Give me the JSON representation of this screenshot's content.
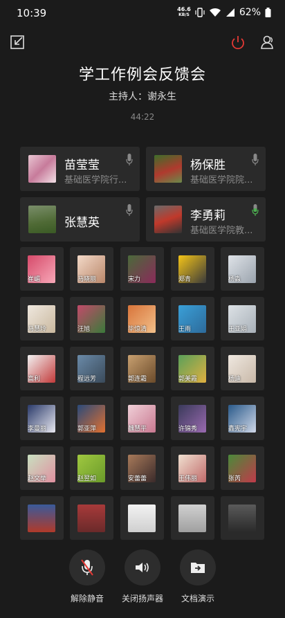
{
  "status": {
    "time": "10:39",
    "net_speed": "46.6",
    "net_unit": "KB/S",
    "battery": "62%"
  },
  "meeting": {
    "title": "学工作例会反馈会",
    "host": "主持人：谢永生",
    "timer": "44:22"
  },
  "speakers": [
    {
      "name": "苗莹莹",
      "dept": "基础医学院行..."
    },
    {
      "name": "杨保胜",
      "dept": "基础医学院院..."
    },
    {
      "name": "张慧英",
      "dept": ""
    },
    {
      "name": "李勇莉",
      "dept": "基础医学院教..."
    }
  ],
  "participants": [
    {
      "name": "崔嵋"
    },
    {
      "name": "马晓丽"
    },
    {
      "name": "宋力"
    },
    {
      "name": "郑青"
    },
    {
      "name": "杨淼"
    },
    {
      "name": "马慧玲"
    },
    {
      "name": "汪旭"
    },
    {
      "name": "毕惊清"
    },
    {
      "name": "王雨"
    },
    {
      "name": "王亚娟"
    },
    {
      "name": "高利"
    },
    {
      "name": "程远芳"
    },
    {
      "name": "郭连霜"
    },
    {
      "name": "郭美霞"
    },
    {
      "name": "杨迪"
    },
    {
      "name": "李曼丽"
    },
    {
      "name": "郭亚萍"
    },
    {
      "name": "魏慧平"
    },
    {
      "name": "许锦秀"
    },
    {
      "name": "鑫宪宇"
    },
    {
      "name": "赵文举"
    },
    {
      "name": "赵翌如"
    },
    {
      "name": "安蕾蕾"
    },
    {
      "name": "王伟丽"
    },
    {
      "name": "张芮"
    }
  ],
  "controls": {
    "mute": "解除静音",
    "speaker": "关闭扬声器",
    "doc": "文档演示"
  },
  "colors": {
    "bg": "#1b1b1b",
    "tile": "#2a2a2a",
    "power": "#e53935",
    "mic_active": "#4caf50"
  }
}
